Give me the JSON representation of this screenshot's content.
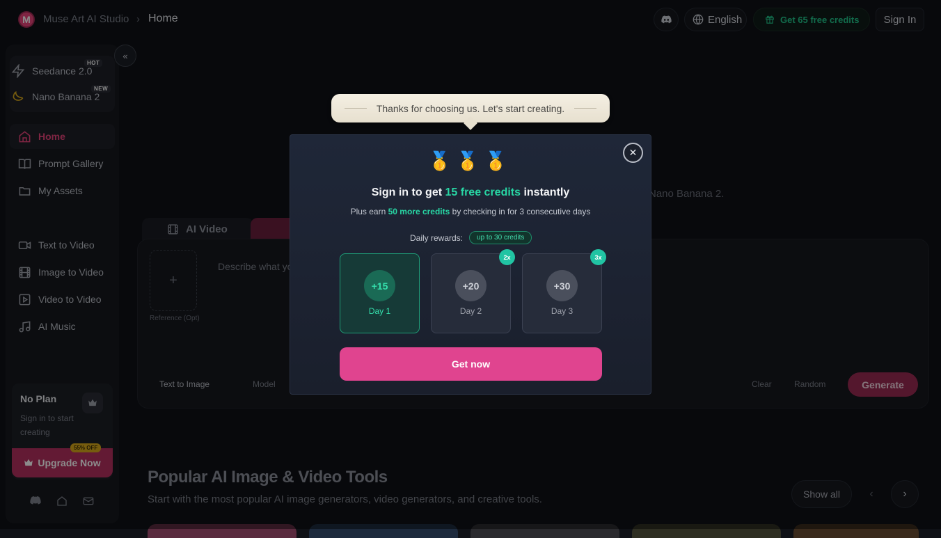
{
  "header": {
    "logo_letter": "M",
    "brand": "Muse Art AI Studio",
    "crumb_sep": "›",
    "crumb": "Home",
    "language": "English",
    "credits_label": "Get 65 free credits",
    "sign_in": "Sign In"
  },
  "sidebar": {
    "collapse_glyph": "«",
    "models": [
      {
        "label": "Seedance 2.0",
        "badge": "HOT"
      },
      {
        "label": "Nano Banana 2",
        "badge": "NEW"
      }
    ],
    "nav": [
      {
        "label": "Home",
        "icon": "home-icon"
      },
      {
        "label": "Prompt Gallery",
        "icon": "book-icon"
      },
      {
        "label": "My Assets",
        "icon": "folder-icon"
      }
    ],
    "tools": [
      {
        "label": "Text to Video",
        "icon": "video-icon"
      },
      {
        "label": "Image to Video",
        "icon": "film-icon"
      },
      {
        "label": "Video to Video",
        "icon": "play-square-icon"
      },
      {
        "label": "AI Music",
        "icon": "music-icon"
      }
    ],
    "plan": {
      "title": "No Plan",
      "subtitle": "Sign in to start creating",
      "upgrade": "Upgrade Now",
      "discount": "55% OFF"
    }
  },
  "main": {
    "bg_text": "Nano Banana 2.",
    "tab_video": "AI Video",
    "prompt_placeholder": "Describe what yo",
    "ref_label": "Reference (Opt)",
    "ref_plus": "+",
    "mode": "Text to Image",
    "model": "Model",
    "clear": "Clear",
    "random": "Random",
    "generate": "Generate",
    "section_title": "Popular AI Image & Video Tools",
    "section_sub": "Start with the most popular AI image generators, video generators, and creative tools.",
    "show_all": "Show all",
    "prev_glyph": "‹",
    "next_glyph": "›"
  },
  "tooltip": {
    "text": "Thanks for choosing us. Let's start creating."
  },
  "modal": {
    "medals": "🥇🥇🥇",
    "close_glyph": "✕",
    "title_pre": "Sign in to get ",
    "title_hl": "15 free credits",
    "title_post": " instantly",
    "sub_pre": "Plus earn ",
    "sub_hl": "50 more credits",
    "sub_post": " by checking in for 3 consecutive days",
    "daily_label": "Daily rewards:",
    "daily_pill": "up to 30 credits",
    "days": [
      {
        "amount": "+15",
        "label": "Day 1",
        "mult": ""
      },
      {
        "amount": "+20",
        "label": "Day 2",
        "mult": "2x"
      },
      {
        "amount": "+30",
        "label": "Day 3",
        "mult": "3x"
      }
    ],
    "cta": "Get now"
  },
  "colors": {
    "accent": "#e0448f",
    "success": "#28d6a4",
    "background": "#0f1116"
  }
}
